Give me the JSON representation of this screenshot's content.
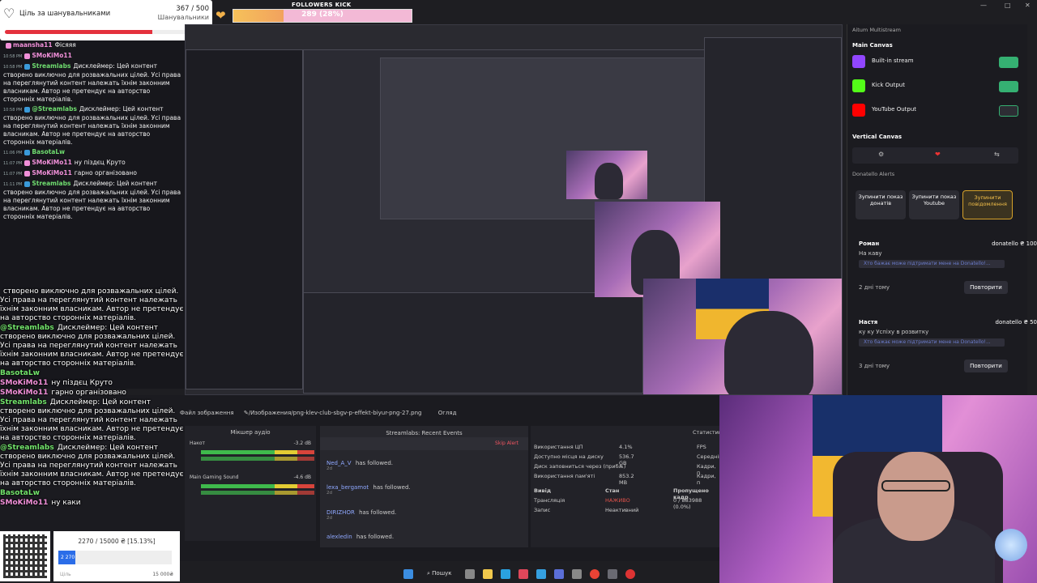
{
  "goal": {
    "title": "Ціль за шанувальниками",
    "count": "367 / 500",
    "label": "Шанувальники",
    "progress": 0.734
  },
  "kick": {
    "title": "FOLLOWERS KICK",
    "value": "289 (28%)",
    "progress": 0.28
  },
  "chat": [
    {
      "time": "",
      "user": "maansha11",
      "msg": "Фісяяя",
      "color": "pink"
    },
    {
      "time": "10:58 PM",
      "user": "SMoKiMo11",
      "msg": "",
      "color": "pink"
    },
    {
      "time": "10:58 PM",
      "user": "Streamlabs",
      "msg": "Дисклеймер: Цей контент створено виключно для розважальних цілей. Усі права на переглянутий контент належать їхнім законним власникам. Автор не претендує на авторство сторонніх матеріалів.",
      "color": "green"
    },
    {
      "time": "10:58 PM",
      "user": "@Streamlabs",
      "msg": "Дисклеймер: Цей контент створено виключно для розважальних цілей. Усі права на переглянутий контент належать їхнім законним власникам. Автор не претендує на авторство сторонніх матеріалів.",
      "color": "green"
    },
    {
      "time": "11:06 PM",
      "user": "BasotaLw",
      "msg": "",
      "color": "green"
    },
    {
      "time": "11:07 PM",
      "user": "SMoKiMo11",
      "msg": "ну піздєц Круто",
      "color": "pink"
    },
    {
      "time": "11:07 PM",
      "user": "SMoKiMo11",
      "msg": "гарно організовано",
      "color": "pink"
    },
    {
      "time": "11:11 PM",
      "user": "Streamlabs",
      "msg": "Дисклеймер: Цей контент створено виключно для розважальних цілей. Усі права на переглянутий контент належать їхнім законним власникам. Автор не претендує на авторство сторонніх матеріалів.",
      "color": "green"
    }
  ],
  "overlay_chat": [
    {
      "user": "",
      "msg": "створено виключно для розважальних цілей. Усі права на переглянутий контент належать їхнім законним власникам. Автор не претендує на авторство сторонніх матеріалів."
    },
    {
      "user": "@Streamlabs",
      "msg": "Дисклеймер: Цей контент створено виключно для розважальних цілей. Усі права на переглянутий контент належать їхнім законним власникам. Автор не претендує на авторство сторонніх матеріалів."
    },
    {
      "user": "BasotaLw",
      "msg": ""
    },
    {
      "user": "SMoKiMo11",
      "msg": "ну піздєц Круто",
      "pink": true
    },
    {
      "user": "SMoKiMo11",
      "msg": "гарно організовано",
      "pink": true
    },
    {
      "user": "Streamlabs",
      "msg": "Дисклеймер: Цей контент створено виключно для розважальних цілей. Усі права на переглянутий контент належать їхнім законним власникам. Автор не претендує на авторство сторонніх матеріалів."
    },
    {
      "user": "@Streamlabs",
      "msg": "Дисклеймер: Цей контент створено виключно для розважальних цілей. Усі права на переглянутий контент належать їхнім законним власникам. Автор не претендує на авторство сторонніх матеріалів."
    },
    {
      "user": "BasotaLw",
      "msg": ""
    },
    {
      "user": "SMoKiMo11",
      "msg": "ну каки",
      "pink": true
    }
  ],
  "dock": {
    "header": "Aitum Multistream",
    "main_canvas": "Main Canvas",
    "outputs": [
      {
        "label": "Built-in stream",
        "color": "#9146ff"
      },
      {
        "label": "Kick Output",
        "color": "#53fc18"
      },
      {
        "label": "YouTube Output",
        "color": "#ff0000"
      }
    ],
    "vertical_canvas": "Vertical Canvas",
    "donatello_header": "Donatello Alerts",
    "buttons": [
      "Зупинити показ донатів",
      "Зупинити показ Youtube",
      "Зупинити повідомлення"
    ],
    "donations": [
      {
        "name": "Роман",
        "amount": "donatello ₴ 100",
        "msg": "На каву",
        "field": "Хто бажає може підтримати мене на Donatello!...",
        "ago": "2 дні тому",
        "repeat": "Повторити"
      },
      {
        "name": "Настя",
        "amount": "donatello ₴ 50",
        "msg": "ку ку Успіху в розвитку",
        "field": "Хто бажає може підтримати мене на Donatello!...",
        "ago": "3 дні тому",
        "repeat": "Повторити"
      }
    ]
  },
  "bottom": {
    "tabs": [
      "Файл зображення",
      "✎/Изображения/png-klev-club-sbgv-p-effekt-biyur-png-27.png",
      "Огляд"
    ],
    "mixer_title": "Мікшер аудіо",
    "tracks": [
      {
        "name": "Накот",
        "db": "-3.2 dB"
      },
      {
        "name": "Main Gaming Sound",
        "db": "-4.6 dB"
      }
    ],
    "recent_title": "Streamlabs: Recent Events",
    "skip_alert": "Skip Alert",
    "events": [
      {
        "who": "Ned_A_V",
        "text": "has followed.",
        "ago": "2d"
      },
      {
        "who": "lexa_bergamot",
        "text": "has followed.",
        "ago": "2d"
      },
      {
        "who": "DIRIZHOR",
        "text": "has followed.",
        "ago": "2d"
      },
      {
        "who": "alexledin",
        "text": "has followed.",
        "ago": ""
      }
    ],
    "stats_title": "Статистика",
    "stats": [
      {
        "label": "Використання ЦП",
        "value": "4.1%"
      },
      {
        "label": "Доступно місця на диску",
        "value": "536.7 GB"
      },
      {
        "label": "Диск заповниться через (прибл.)",
        "value": "∞"
      },
      {
        "label": "Використання пам'яті",
        "value": "853.2 MB"
      }
    ],
    "stats_cols": [
      "Вивід",
      "Стан",
      "Пропущено кадр"
    ],
    "stats_rows": [
      {
        "name": "Трансляція",
        "state": "НАЖИВО",
        "dropped": "0 / 883988 (0.0%)"
      },
      {
        "name": "Запис",
        "state": "Неактивний",
        "dropped": ""
      }
    ],
    "fps": "FPS",
    "extra": [
      "Середній",
      "Кадри, п",
      "Кадри, п"
    ]
  },
  "taskbar": {
    "search": "Пошук"
  },
  "donate_goal": {
    "text": "2270 / 15000 ₴ [15.13%]",
    "fill_label": "2 270",
    "min": "Ціль",
    "max": "15 000₴",
    "progress": 0.1513
  }
}
